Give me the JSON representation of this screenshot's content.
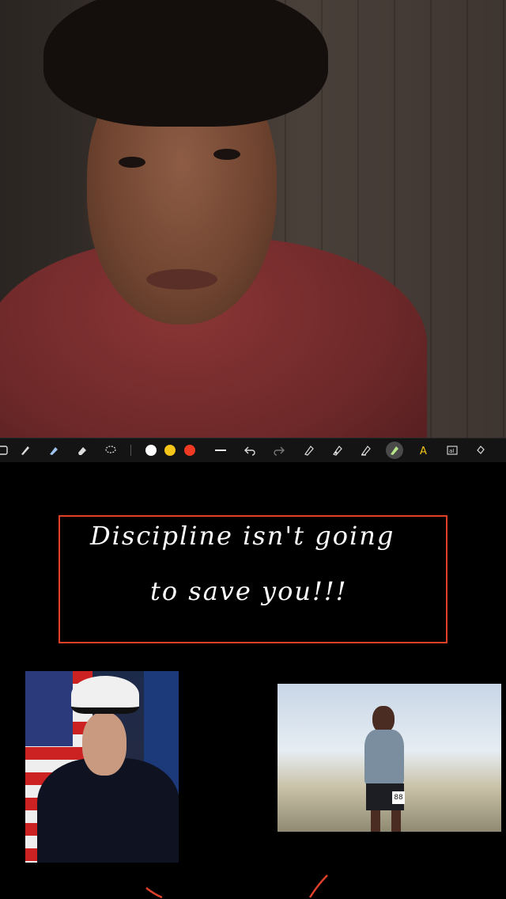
{
  "toolbar": {
    "tools": [
      "pen-tool",
      "marker-tool",
      "highlighter-tool",
      "eraser-tool",
      "lasso-tool"
    ],
    "colors": [
      "#ffffff",
      "#f5c518",
      "#f03a24"
    ],
    "right_tools": [
      "line-tool",
      "undo",
      "redo",
      "shape-tool",
      "ink-tool",
      "trace-tool",
      "active-pen",
      "text-a-tool",
      "textbox-tool",
      "fill-tool"
    ]
  },
  "canvas": {
    "quote_line1": "Discipline isn't going",
    "quote_line2": "to save you!!!",
    "runner_bib": "88"
  },
  "colors": {
    "box_border": "#e0402a",
    "toolbar_bg": "#141414"
  }
}
